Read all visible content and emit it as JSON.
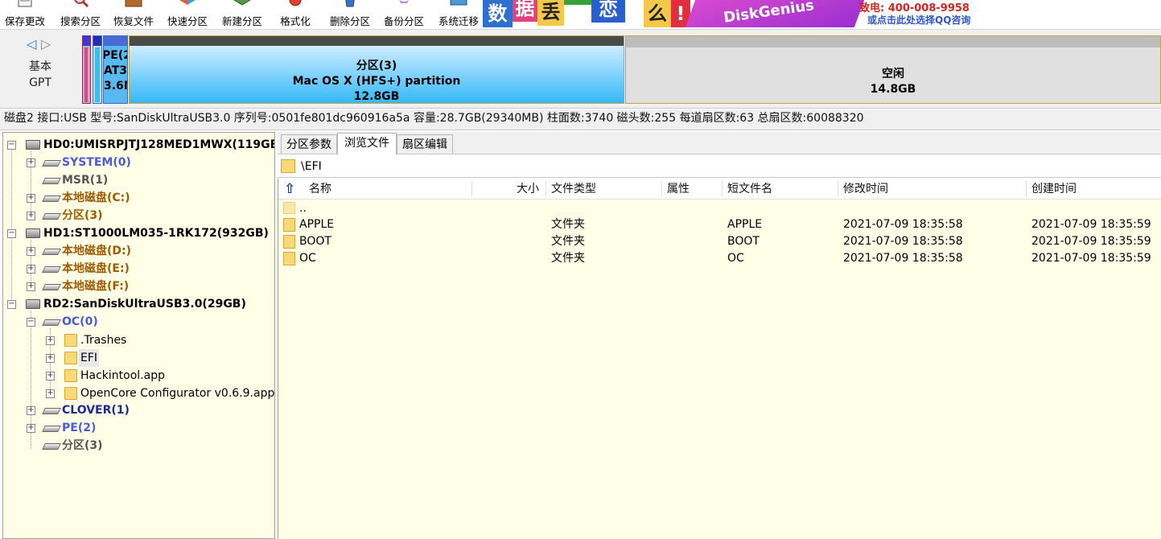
{
  "toolbar": {
    "buttons": [
      {
        "label": "保存更改",
        "icon": "save-icon"
      },
      {
        "label": "搜索分区",
        "icon": "magnifier-icon"
      },
      {
        "label": "恢复文件",
        "icon": "box-icon"
      },
      {
        "label": "快速分区",
        "icon": "pie-icon"
      },
      {
        "label": "新建分区",
        "icon": "new-partition-icon"
      },
      {
        "label": "格式化",
        "icon": "format-icon"
      },
      {
        "label": "删除分区",
        "icon": "trash-icon"
      },
      {
        "label": "备份分区",
        "icon": "backup-icon"
      },
      {
        "label": "系统迁移",
        "icon": "monitor-icon"
      }
    ]
  },
  "ad": {
    "chars": [
      "数",
      "据",
      "丢",
      "恋",
      "么",
      "!"
    ],
    "brand": "DiskGenius",
    "phone": "致电: 400-008-9958",
    "sub": "或点击此处选择QQ咨询"
  },
  "diskbar": {
    "disk_type_line1": "基本",
    "disk_type_line2": "GPT",
    "pe_lines": [
      "PE(2",
      "AT3",
      "3.6M"
    ],
    "partition3": {
      "name": "分区(3)",
      "fs": "Mac OS X (HFS+) partition",
      "size": "12.8GB"
    },
    "free": {
      "name": "空闲",
      "size": "14.8GB"
    }
  },
  "diskinfo": "磁盘2 接口:USB  型号:SanDiskUltraUSB3.0  序列号:0501fe801dc960916a5a  容量:28.7GB(29340MB)  柱面数:3740  磁头数:255  每道扇区数:63  总扇区数:60088320",
  "tree": {
    "hd0": "HD0:UMISRPJTJ128MED1MWX(119GB",
    "hd0_parts": [
      "SYSTEM(0)",
      "MSR(1)",
      "本地磁盘(C:)",
      "分区(3)"
    ],
    "hd1": "HD1:ST1000LM035-1RK172(932GB)",
    "hd1_parts": [
      "本地磁盘(D:)",
      "本地磁盘(E:)",
      "本地磁盘(F:)"
    ],
    "rd2": "RD2:SanDiskUltraUSB3.0(29GB)",
    "oc": "OC(0)",
    "oc_children": [
      ".Trashes",
      "EFI",
      "Hackintool.app",
      "OpenCore Configurator v0.6.9.app"
    ],
    "rd2_parts": [
      "CLOVER(1)",
      "PE(2)",
      "分区(3)"
    ]
  },
  "tabs": [
    "分区参数",
    "浏览文件",
    "扇区编辑"
  ],
  "path": "\\EFI",
  "columns": [
    "名称",
    "大小",
    "文件类型",
    "属性",
    "短文件名",
    "修改时间",
    "创建时间"
  ],
  "files": [
    {
      "name": "..",
      "size": "",
      "type": "",
      "attr": "",
      "short": "",
      "modified": "",
      "created": ""
    },
    {
      "name": "APPLE",
      "size": "",
      "type": "文件夹",
      "attr": "",
      "short": "APPLE",
      "modified": "2021-07-09 18:35:58",
      "created": "2021-07-09 18:35:59"
    },
    {
      "name": "BOOT",
      "size": "",
      "type": "文件夹",
      "attr": "",
      "short": "BOOT",
      "modified": "2021-07-09 18:35:58",
      "created": "2021-07-09 18:35:59"
    },
    {
      "name": "OC",
      "size": "",
      "type": "文件夹",
      "attr": "",
      "short": "OC",
      "modified": "2021-07-09 18:35:58",
      "created": "2021-07-09 18:35:59"
    }
  ],
  "colors": {
    "tree_bg": "#ffffe8",
    "system_blue": "#4a5ad8",
    "local_brown": "#a05a00",
    "partition_gray": "#555555",
    "hfs_cyan": "#2ea8f0"
  }
}
